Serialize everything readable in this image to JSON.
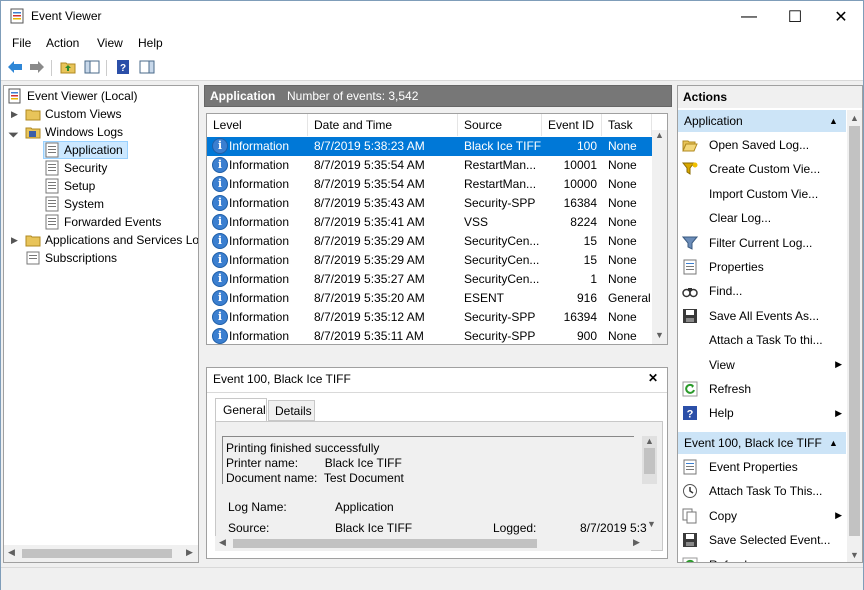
{
  "window": {
    "title": "Event Viewer",
    "minimize": "—",
    "maximize": "☐",
    "close": "✕"
  },
  "menu": [
    "File",
    "Action",
    "View",
    "Help"
  ],
  "tree": {
    "root": "Event Viewer (Local)",
    "custom_views": "Custom Views",
    "windows_logs": "Windows Logs",
    "logs": [
      "Application",
      "Security",
      "Setup",
      "System",
      "Forwarded Events"
    ],
    "apps_services": "Applications and Services Lo",
    "subscriptions": "Subscriptions"
  },
  "center": {
    "log_name": "Application",
    "event_count": "Number of events: 3,542",
    "columns": [
      "Level",
      "Date and Time",
      "Source",
      "Event ID",
      "Task C..."
    ],
    "rows": [
      [
        "Information",
        "8/7/2019 5:38:23 AM",
        "Black Ice TIFF",
        "100",
        "None"
      ],
      [
        "Information",
        "8/7/2019 5:35:54 AM",
        "RestartMan...",
        "10001",
        "None"
      ],
      [
        "Information",
        "8/7/2019 5:35:54 AM",
        "RestartMan...",
        "10000",
        "None"
      ],
      [
        "Information",
        "8/7/2019 5:35:43 AM",
        "Security-SPP",
        "16384",
        "None"
      ],
      [
        "Information",
        "8/7/2019 5:35:41 AM",
        "VSS",
        "8224",
        "None"
      ],
      [
        "Information",
        "8/7/2019 5:35:29 AM",
        "SecurityCen...",
        "15",
        "None"
      ],
      [
        "Information",
        "8/7/2019 5:35:29 AM",
        "SecurityCen...",
        "15",
        "None"
      ],
      [
        "Information",
        "8/7/2019 5:35:27 AM",
        "SecurityCen...",
        "1",
        "None"
      ],
      [
        "Information",
        "8/7/2019 5:35:20 AM",
        "ESENT",
        "916",
        "General"
      ],
      [
        "Information",
        "8/7/2019 5:35:12 AM",
        "Security-SPP",
        "16394",
        "None"
      ],
      [
        "Information",
        "8/7/2019 5:35:11 AM",
        "Security-SPP",
        "900",
        "None"
      ]
    ]
  },
  "detail": {
    "title": "Event 100, Black Ice TIFF",
    "close": "✕",
    "tabs": [
      "General",
      "Details"
    ],
    "message_lines": [
      "Printing finished successfully",
      "Printer name:        Black Ice TIFF",
      "Document name:  Test Document"
    ],
    "log_name_label": "Log Name:",
    "log_name_value": "Application",
    "source_label": "Source:",
    "source_value": "Black Ice TIFF",
    "logged_label": "Logged:",
    "logged_value": "8/7/2019 5:3"
  },
  "actions": {
    "header": "Actions",
    "section1": "Application",
    "section1_items": [
      {
        "label": "Open Saved Log...",
        "icon": "folder-open-icon"
      },
      {
        "label": "Create Custom Vie...",
        "icon": "filter-star-icon"
      },
      {
        "label": "Import Custom Vie...",
        "icon": ""
      },
      {
        "label": "Clear Log...",
        "icon": ""
      },
      {
        "label": "Filter Current Log...",
        "icon": "filter-icon"
      },
      {
        "label": "Properties",
        "icon": "properties-icon"
      },
      {
        "label": "Find...",
        "icon": "binoculars-icon"
      },
      {
        "label": "Save All Events As...",
        "icon": "save-icon"
      },
      {
        "label": "Attach a Task To thi...",
        "icon": ""
      },
      {
        "label": "View",
        "icon": ""
      },
      {
        "label": "Refresh",
        "icon": "refresh-icon"
      },
      {
        "label": "Help",
        "icon": "help-icon"
      }
    ],
    "section2": "Event 100, Black Ice TIFF",
    "section2_items": [
      {
        "label": "Event Properties",
        "icon": "properties-icon"
      },
      {
        "label": "Attach Task To This...",
        "icon": "task-icon"
      },
      {
        "label": "Copy",
        "icon": "copy-icon"
      },
      {
        "label": "Save Selected Event...",
        "icon": "save-icon"
      },
      {
        "label": "Refresh",
        "icon": "refresh-icon"
      }
    ]
  }
}
